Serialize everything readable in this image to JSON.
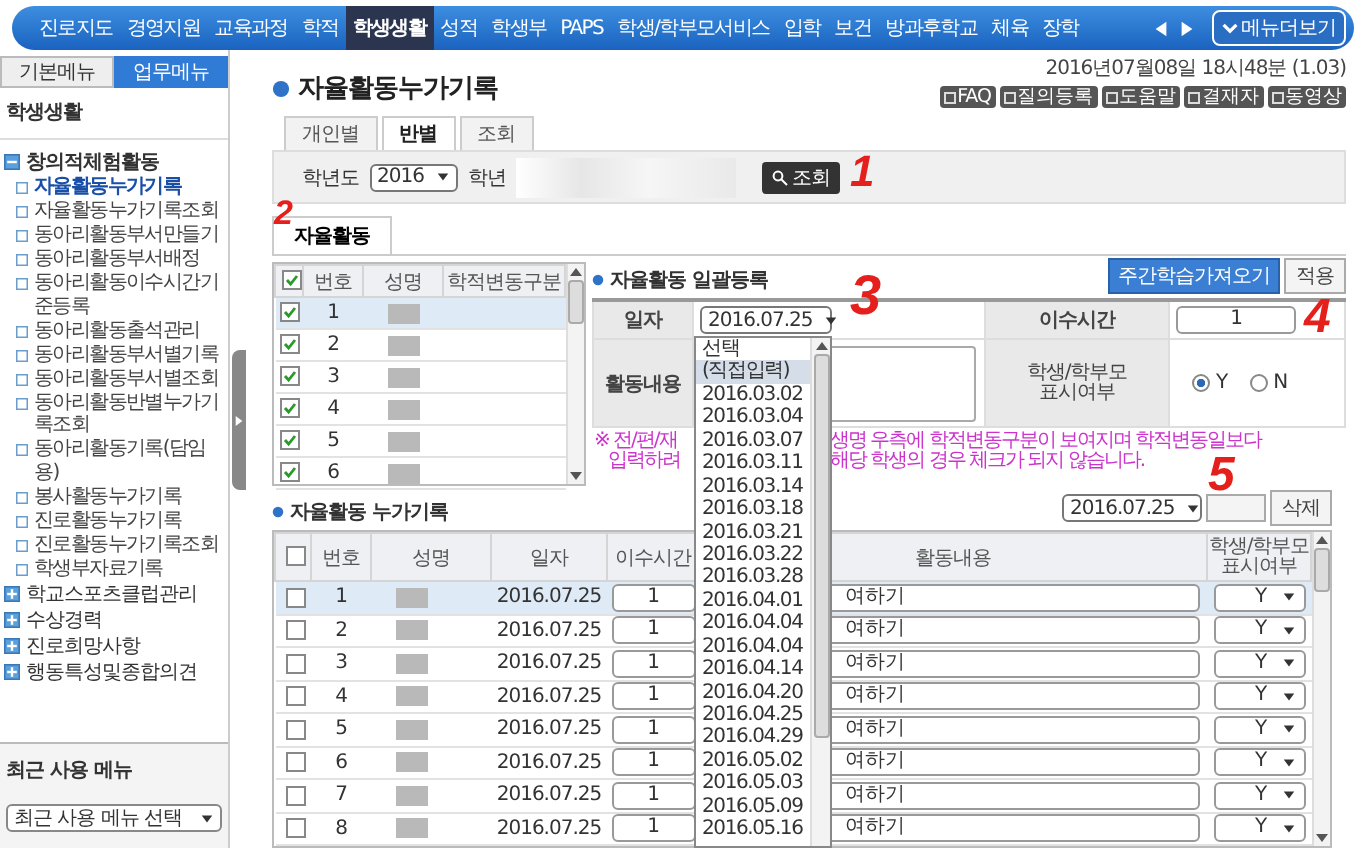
{
  "top_menu": {
    "items": [
      {
        "label": "진로지도",
        "selected": false
      },
      {
        "label": "경영지원",
        "selected": false
      },
      {
        "label": "교육과정",
        "selected": false
      },
      {
        "label": "학적",
        "selected": false
      },
      {
        "label": "학생생활",
        "selected": true
      },
      {
        "label": "성적",
        "selected": false
      },
      {
        "label": "학생부",
        "selected": false
      },
      {
        "label": "PAPS",
        "selected": false
      },
      {
        "label": "학생/학부모서비스",
        "selected": false
      },
      {
        "label": "입학",
        "selected": false
      },
      {
        "label": "보건",
        "selected": false
      },
      {
        "label": "방과후학교",
        "selected": false
      },
      {
        "label": "체육",
        "selected": false
      },
      {
        "label": "장학",
        "selected": false
      }
    ],
    "more_button": "메뉴더보기"
  },
  "sidebar": {
    "tabs": [
      {
        "label": "기본메뉴",
        "selected": false
      },
      {
        "label": "업무메뉴",
        "selected": true
      }
    ],
    "section_title": "학생생활",
    "tree": [
      {
        "label": "창의적체험활동",
        "expanded": true,
        "children": [
          {
            "label": "자율활동누가기록",
            "selected": true
          },
          {
            "label": "자율활동누가기록조회",
            "selected": false
          },
          {
            "label": "동아리활동부서만들기",
            "selected": false
          },
          {
            "label": "동아리활동부서배정",
            "selected": false
          },
          {
            "label": "동아리활동이수시간기준등록",
            "selected": false
          },
          {
            "label": "동아리활동출석관리",
            "selected": false
          },
          {
            "label": "동아리활동부서별기록",
            "selected": false
          },
          {
            "label": "동아리활동부서별조회",
            "selected": false
          },
          {
            "label": "동아리활동반별누가기록조회",
            "selected": false
          },
          {
            "label": "동아리활동기록(담임용)",
            "selected": false
          },
          {
            "label": "봉사활동누가기록",
            "selected": false
          },
          {
            "label": "진로활동누가기록",
            "selected": false
          },
          {
            "label": "진로활동누가기록조회",
            "selected": false
          },
          {
            "label": "학생부자료기록",
            "selected": false
          }
        ]
      },
      {
        "label": "학교스포츠클럽관리",
        "expanded": false
      },
      {
        "label": "수상경력",
        "expanded": false
      },
      {
        "label": "진로희망사항",
        "expanded": false
      },
      {
        "label": "행동특성및종합의견",
        "expanded": false
      }
    ],
    "recent": {
      "title": "최근 사용 메뉴",
      "select": "최근 사용 메뉴 선택"
    }
  },
  "page": {
    "title": "자율활동누가기록",
    "timestamp": "2016년07월08일 18시48분 (1.03)",
    "help_buttons": [
      "FAQ",
      "질의등록",
      "도움말",
      "결재자",
      "동영상"
    ]
  },
  "view_tabs": [
    {
      "label": "개인별",
      "selected": false
    },
    {
      "label": "반별",
      "selected": true
    },
    {
      "label": "조회",
      "selected": false
    }
  ],
  "filter": {
    "year_label": "학년도",
    "year": "2016",
    "grade_label": "학년",
    "search_button": "조회"
  },
  "section_tab": "자율활동",
  "student_table": {
    "columns": [
      "번호",
      "성명",
      "학적변동구분"
    ],
    "all_checked": true,
    "rows": [
      {
        "number": "1",
        "checked": true,
        "selected": true
      },
      {
        "number": "2",
        "checked": true,
        "selected": false
      },
      {
        "number": "3",
        "checked": true,
        "selected": false
      },
      {
        "number": "4",
        "checked": true,
        "selected": false
      },
      {
        "number": "5",
        "checked": true,
        "selected": false
      },
      {
        "number": "6",
        "checked": true,
        "selected": false
      }
    ]
  },
  "batch_form": {
    "title": "자율활동 일괄등록",
    "weekly_button": "주간학습가져오기",
    "apply_button": "적용",
    "date_label": "일자",
    "date": "2016.07.25",
    "hours_label": "이수시간",
    "hours": "1",
    "content_label": "활동내용",
    "display_label": "학생/학부모 표시여부",
    "options": [
      {
        "label": "Y",
        "selected": true
      },
      {
        "label": "N",
        "selected": false
      }
    ]
  },
  "note": {
    "lines": [
      {
        "left": "※ 전/편/재",
        "right": "생명 우측에 학적변동구분이 보여지며 학적변동일보다"
      },
      {
        "left": "입력하려",
        "right": "해당 학생의 경우 체크가 되지 않습니다."
      }
    ]
  },
  "date_dropdown": {
    "options": [
      {
        "label": "선택",
        "selected": false
      },
      {
        "label": "(직접입력)",
        "selected": true
      },
      {
        "label": "2016.03.02",
        "selected": false
      },
      {
        "label": "2016.03.04",
        "selected": false
      },
      {
        "label": "2016.03.07",
        "selected": false
      },
      {
        "label": "2016.03.11",
        "selected": false
      },
      {
        "label": "2016.03.14",
        "selected": false
      },
      {
        "label": "2016.03.18",
        "selected": false
      },
      {
        "label": "2016.03.21",
        "selected": false
      },
      {
        "label": "2016.03.22",
        "selected": false
      },
      {
        "label": "2016.03.28",
        "selected": false
      },
      {
        "label": "2016.04.01",
        "selected": false
      },
      {
        "label": "2016.04.04",
        "selected": false
      },
      {
        "label": "2016.04.04",
        "selected": false
      },
      {
        "label": "2016.04.14",
        "selected": false
      },
      {
        "label": "2016.04.20",
        "selected": false
      },
      {
        "label": "2016.04.25",
        "selected": false
      },
      {
        "label": "2016.04.29",
        "selected": false
      },
      {
        "label": "2016.05.02",
        "selected": false
      },
      {
        "label": "2016.05.03",
        "selected": false
      },
      {
        "label": "2016.05.09",
        "selected": false
      },
      {
        "label": "2016.05.16",
        "selected": false
      }
    ]
  },
  "records": {
    "title": "자율활동 누가기록",
    "date_filter": "2016.07.25",
    "delete_button": "삭제",
    "columns": [
      "번호",
      "성명",
      "일자",
      "이수시간",
      "활동내용",
      "학생/학부모 표시여부"
    ],
    "all_checked": false,
    "rows": [
      {
        "number": "1",
        "date": "2016.07.25",
        "hours": "1",
        "content": "여하기",
        "display": "Y",
        "checked": false,
        "selected": true
      },
      {
        "number": "2",
        "date": "2016.07.25",
        "hours": "1",
        "content": "여하기",
        "display": "Y",
        "checked": false,
        "selected": false
      },
      {
        "number": "3",
        "date": "2016.07.25",
        "hours": "1",
        "content": "여하기",
        "display": "Y",
        "checked": false,
        "selected": false
      },
      {
        "number": "4",
        "date": "2016.07.25",
        "hours": "1",
        "content": "여하기",
        "display": "Y",
        "checked": false,
        "selected": false
      },
      {
        "number": "5",
        "date": "2016.07.25",
        "hours": "1",
        "content": "여하기",
        "display": "Y",
        "checked": false,
        "selected": false
      },
      {
        "number": "6",
        "date": "2016.07.25",
        "hours": "1",
        "content": "여하기",
        "display": "Y",
        "checked": false,
        "selected": false
      },
      {
        "number": "7",
        "date": "2016.07.25",
        "hours": "1",
        "content": "여하기",
        "display": "Y",
        "checked": false,
        "selected": false
      },
      {
        "number": "8",
        "date": "2016.07.25",
        "hours": "1",
        "content": "여하기",
        "display": "Y",
        "checked": false,
        "selected": false
      }
    ]
  },
  "annotations": [
    "1",
    "2",
    "3",
    "4",
    "5"
  ]
}
